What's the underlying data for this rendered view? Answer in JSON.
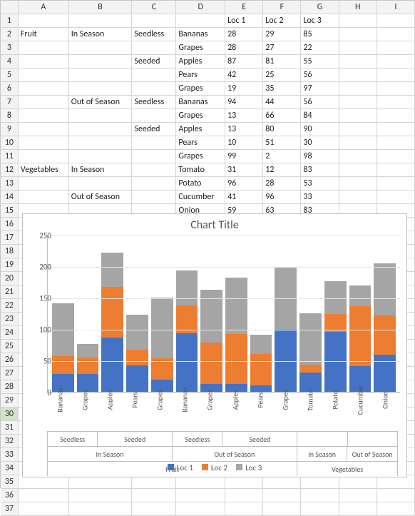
{
  "columns": [
    "A",
    "B",
    "C",
    "D",
    "E",
    "F",
    "G",
    "H",
    "I"
  ],
  "headers": {
    "E": "Loc 1",
    "F": "Loc 2",
    "G": "Loc 3"
  },
  "rows": [
    {
      "r": 2,
      "A": "Fruit",
      "B": "In Season",
      "C": "Seedless",
      "D": "Bananas",
      "E": 28,
      "F": 29,
      "G": 85
    },
    {
      "r": 3,
      "A": "",
      "B": "",
      "C": "",
      "D": "Grapes",
      "E": 28,
      "F": 27,
      "G": 22
    },
    {
      "r": 4,
      "A": "",
      "B": "",
      "C": "Seeded",
      "D": "Apples",
      "E": 87,
      "F": 81,
      "G": 55
    },
    {
      "r": 5,
      "A": "",
      "B": "",
      "C": "",
      "D": "Pears",
      "E": 42,
      "F": 25,
      "G": 56
    },
    {
      "r": 6,
      "A": "",
      "B": "",
      "C": "",
      "D": "Grapes",
      "E": 19,
      "F": 35,
      "G": 97
    },
    {
      "r": 7,
      "A": "",
      "B": "Out of Season",
      "C": "Seedless",
      "D": "Bananas",
      "E": 94,
      "F": 44,
      "G": 56
    },
    {
      "r": 8,
      "A": "",
      "B": "",
      "C": "",
      "D": "Grapes",
      "E": 13,
      "F": 66,
      "G": 84
    },
    {
      "r": 9,
      "A": "",
      "B": "",
      "C": "Seeded",
      "D": "Apples",
      "E": 13,
      "F": 80,
      "G": 90
    },
    {
      "r": 10,
      "A": "",
      "B": "",
      "C": "",
      "D": "Pears",
      "E": 10,
      "F": 51,
      "G": 30
    },
    {
      "r": 11,
      "A": "",
      "B": "",
      "C": "",
      "D": "Grapes",
      "E": 99,
      "F": 2,
      "G": 98
    },
    {
      "r": 12,
      "A": "Vegetables",
      "B": "In Season",
      "C": "",
      "D": "Tomato",
      "E": 31,
      "F": 12,
      "G": 83
    },
    {
      "r": 13,
      "A": "",
      "B": "",
      "C": "",
      "D": "Potato",
      "E": 96,
      "F": 28,
      "G": 53
    },
    {
      "r": 14,
      "A": "",
      "B": "Out of Season",
      "C": "",
      "D": "Cucumber",
      "E": 41,
      "F": 96,
      "G": 33
    },
    {
      "r": 15,
      "A": "",
      "B": "",
      "C": "",
      "D": "Onion",
      "E": 59,
      "F": 63,
      "G": 83
    }
  ],
  "selected_row": 30,
  "chart_data": {
    "type": "bar",
    "stacked": true,
    "title": "Chart Title",
    "ylim": [
      0,
      250
    ],
    "yticks": [
      0,
      50,
      100,
      150,
      200,
      250
    ],
    "series_names": [
      "Loc 1",
      "Loc 2",
      "Loc 3"
    ],
    "colors": {
      "Loc 1": "#4472c4",
      "Loc 2": "#ed7d31",
      "Loc 3": "#a5a5a5"
    },
    "groups_level1": [
      {
        "label": "Fruit",
        "span": 10
      },
      {
        "label": "Vegetables",
        "span": 4
      }
    ],
    "groups_level2": [
      {
        "label": "In Season",
        "span": 5
      },
      {
        "label": "Out of Season",
        "span": 5
      },
      {
        "label": "In Season",
        "span": 2
      },
      {
        "label": "Out of Season",
        "span": 2
      }
    ],
    "groups_level3": [
      {
        "label": "Seedless",
        "span": 2
      },
      {
        "label": "Seeded",
        "span": 3
      },
      {
        "label": "Seedless",
        "span": 2
      },
      {
        "label": "Seeded",
        "span": 3
      },
      {
        "label": "",
        "span": 2
      },
      {
        "label": "",
        "span": 2
      }
    ],
    "categories": [
      "Bananas",
      "Grapes",
      "Apples",
      "Pears",
      "Grapes",
      "Bananas",
      "Grapes",
      "Apples",
      "Pears",
      "Grapes",
      "Tomato",
      "Potato",
      "Cucumber",
      "Onion"
    ],
    "series": [
      {
        "name": "Loc 1",
        "values": [
          28,
          28,
          87,
          42,
          19,
          94,
          13,
          13,
          10,
          99,
          31,
          96,
          41,
          59
        ]
      },
      {
        "name": "Loc 2",
        "values": [
          29,
          27,
          81,
          25,
          35,
          44,
          66,
          80,
          51,
          2,
          12,
          28,
          96,
          63
        ]
      },
      {
        "name": "Loc 3",
        "values": [
          85,
          22,
          55,
          56,
          97,
          56,
          84,
          90,
          30,
          98,
          83,
          53,
          33,
          83
        ]
      }
    ]
  }
}
